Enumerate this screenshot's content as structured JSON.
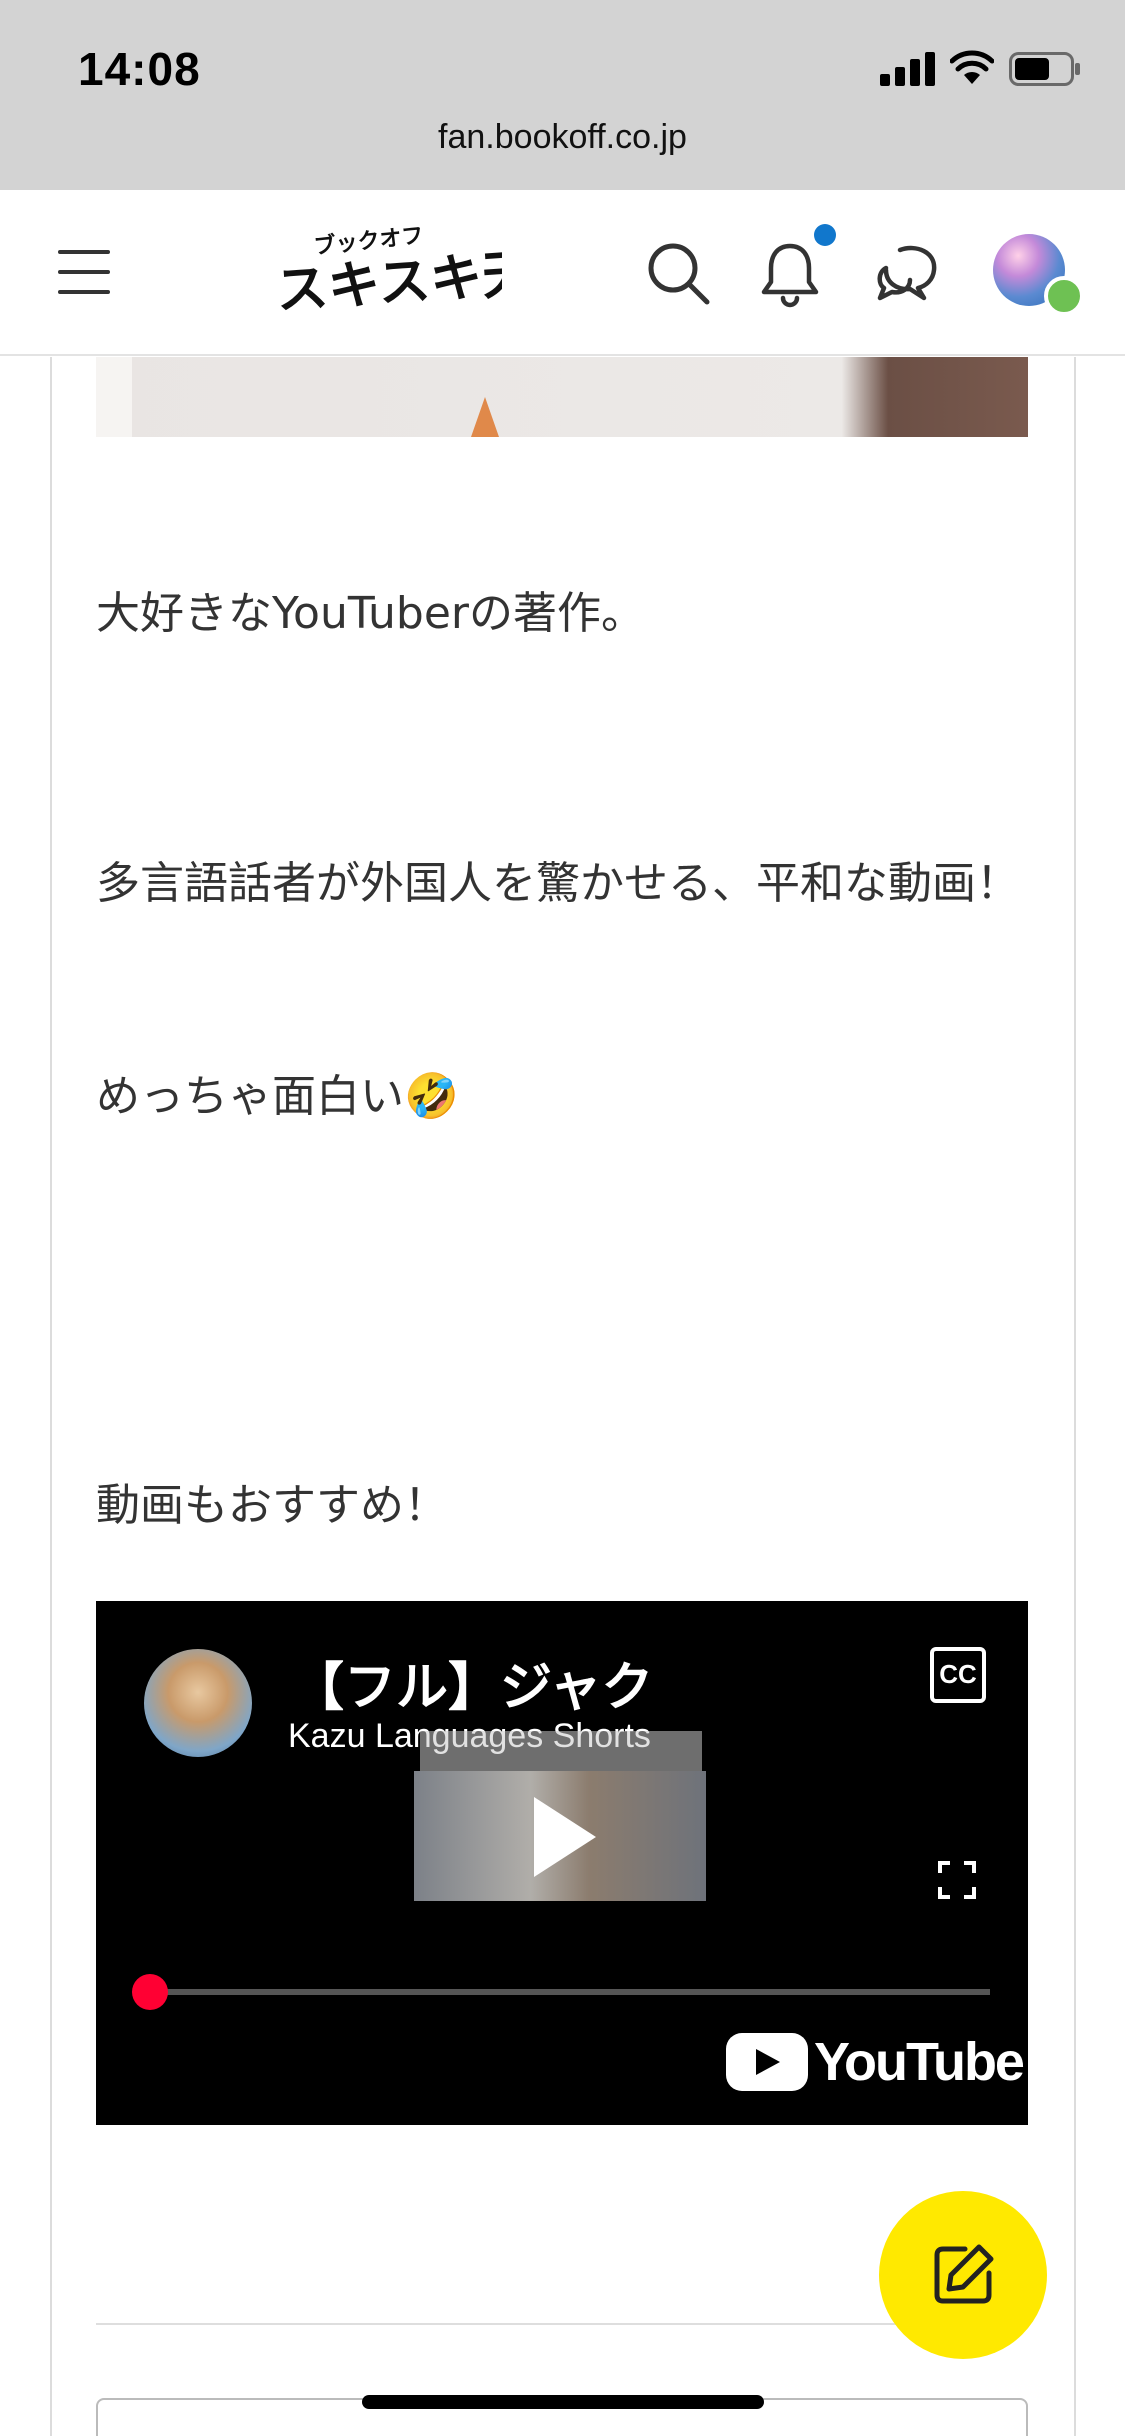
{
  "status_bar": {
    "time": "14:08",
    "url": "fan.bookoff.co.jp"
  },
  "header": {
    "logo_icon": "bookoff-sukisuki-tengoku-logo",
    "icons": [
      "menu-icon",
      "search-icon",
      "bell-icon",
      "chat-icon",
      "avatar"
    ],
    "has_notification": true
  },
  "post": {
    "paragraphs": [
      "大好きなYouTuberの著作。",
      "多言語話者が外国人を驚かせる、平和な動画！",
      "めっちゃ面白い🤣",
      "動画もおすすめ！"
    ]
  },
  "video": {
    "title": "【フル】ジャクソン・",
    "channel": "Kazu Languages Shorts",
    "cc_label": "CC",
    "brand": "YouTube",
    "progress": 0.0
  },
  "colors": {
    "accent_blue": "#1177cc",
    "fab_yellow": "#ffe900",
    "progress_red": "#ff0033"
  }
}
